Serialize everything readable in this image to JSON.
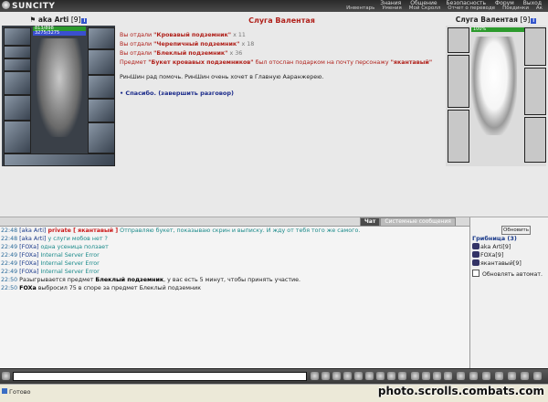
{
  "brand": "SUNCITY",
  "nav_top": [
    "Знания",
    "Общение",
    "Безопасность",
    "Форум",
    "Выход"
  ],
  "nav_bottom": [
    "Инвентарь",
    "Умения",
    "Мой Скролл",
    "Отчет о переводе",
    "Поединки",
    "Ак"
  ],
  "player": {
    "name": "aka Arti",
    "level": "[9]",
    "hp": "813/898",
    "mp": "3275/3275"
  },
  "npc": {
    "name": "Слуга Валентая",
    "level": "[9]",
    "hp": "100%"
  },
  "dialog": {
    "title": "Слуга Валентая",
    "given": [
      {
        "prefix": "Вы отдали ",
        "item": "\"Кровавый подземник\"",
        "qty": " x 11"
      },
      {
        "prefix": "Вы отдали ",
        "item": "\"Черепичный подземник\"",
        "qty": " x 18"
      },
      {
        "prefix": "Вы отдали ",
        "item": "\"Блеклый подземник\"",
        "qty": " x 36"
      }
    ],
    "gift": {
      "prefix": "Предмет ",
      "item": "\"Букет кровавых подземников\"",
      "mid": " был отослан подарком на почту персонажу ",
      "to": "\"якантавый\""
    },
    "speech": "РинШин рад помочь. РинШин очень хочет в Главную Ааранжерею.",
    "answer": "• Спасибо. (завершить разговор)"
  },
  "tabs": {
    "chat": "Чат",
    "system": "Системные сообщения"
  },
  "chat": [
    {
      "time": "22:48",
      "nick": "[aka Arti]",
      "priv": "private [ якантавый ]",
      "text": " Отправляю букет, показываю скрин и выписку. И жду от тебя того же самого."
    },
    {
      "time": "22:48",
      "nick": "[aka Arti]",
      "priv": "",
      "text": " у слуги мобов нет ?"
    },
    {
      "time": "22:49",
      "nick": "[FOXa]",
      "priv": "",
      "text": " одна усеница ползает"
    },
    {
      "time": "22:49",
      "nick": "[FOXa]",
      "priv": "",
      "text": " Internal Server Error"
    },
    {
      "time": "22:49",
      "nick": "[FOXa]",
      "priv": "",
      "text": " Internal Server Error"
    },
    {
      "time": "22:49",
      "nick": "[FOXa]",
      "priv": "",
      "text": " Internal Server Error"
    }
  ],
  "sys_msgs": [
    {
      "time": "22:50",
      "pre": " Разыгрывается предмет ",
      "item": "Блеклый подземник",
      "post": ", у вас есть 5 минут, чтобы принять участие."
    },
    {
      "time": "22:50",
      "pre": " ",
      "item": "FOXa",
      "post": " выбросил 75 в споре за предмет Блеклый подземник"
    }
  ],
  "users_panel": {
    "refresh": "Обновить",
    "room": "Грибница (3)",
    "users": [
      {
        "name": "aka Arti",
        "level": "[9]"
      },
      {
        "name": "FOXa",
        "level": "[9]"
      },
      {
        "name": "якантавый",
        "level": "[9]"
      }
    ],
    "auto_update": "Обновлять автомат."
  },
  "status": "Готово",
  "watermark": "photo.scrolls.combats.com"
}
